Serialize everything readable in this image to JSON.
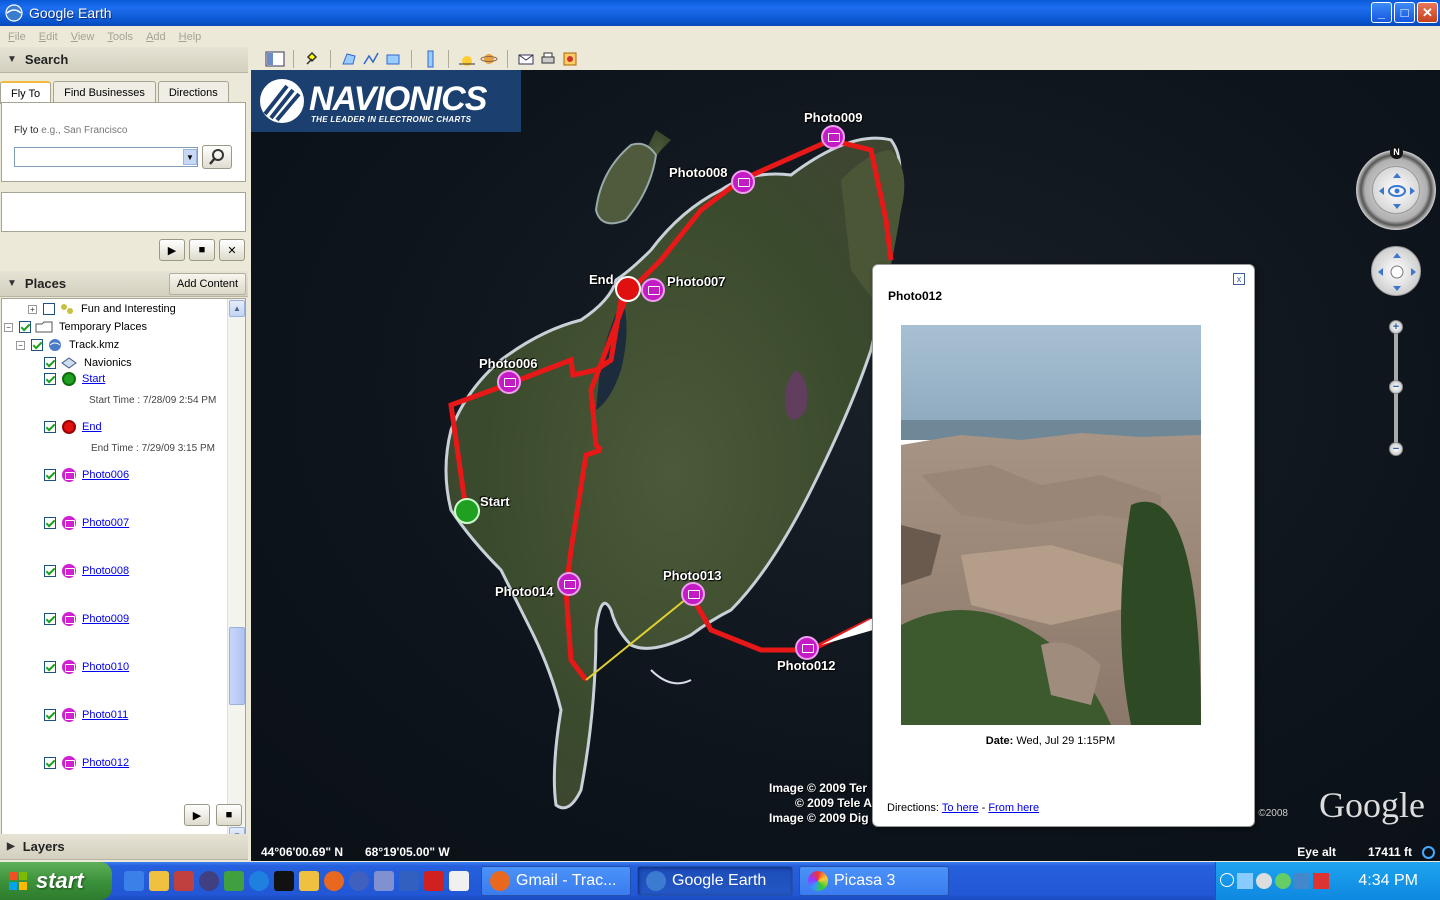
{
  "window": {
    "title": "Google Earth",
    "controls": {
      "minimize": "_",
      "maximize": "□",
      "close": "✕"
    }
  },
  "menu": [
    "File",
    "Edit",
    "View",
    "Tools",
    "Add",
    "Help"
  ],
  "search": {
    "header": "Search",
    "tabs": [
      "Fly To",
      "Find Businesses",
      "Directions"
    ],
    "flyto_label": "Fly to",
    "flyto_example": "e.g., San Francisco",
    "flyto_value": ""
  },
  "places": {
    "header": "Places",
    "add_content": "Add Content",
    "items": [
      {
        "label": "Fun and Interesting",
        "checked": false
      },
      {
        "label": "Temporary Places",
        "checked": true
      },
      {
        "label": "Track.kmz",
        "checked": true
      },
      {
        "label": "Navionics",
        "checked": true
      },
      {
        "label": "Start",
        "checked": true,
        "sub": "Start Time : 7/28/09 2:54 PM"
      },
      {
        "label": "End",
        "checked": true,
        "sub": "End Time : 7/29/09 3:15 PM"
      },
      {
        "label": "Photo006",
        "checked": true
      },
      {
        "label": "Photo007",
        "checked": true
      },
      {
        "label": "Photo008",
        "checked": true
      },
      {
        "label": "Photo009",
        "checked": true
      },
      {
        "label": "Photo010",
        "checked": true
      },
      {
        "label": "Photo011",
        "checked": true
      },
      {
        "label": "Photo012",
        "checked": true
      }
    ]
  },
  "layers": {
    "header": "Layers"
  },
  "map": {
    "navionics_brand": "NAVIONICS",
    "navionics_tagline": "THE LEADER IN ELECTRONIC CHARTS",
    "labels": {
      "photo009": "Photo009",
      "photo008": "Photo008",
      "photo007": "Photo007",
      "photo006": "Photo006",
      "photo013": "Photo013",
      "photo014": "Photo014",
      "photo012": "Photo012",
      "start": "Start",
      "end": "End"
    },
    "credits": [
      "Image © 2009 Ter",
      "© 2009 Tele A",
      "Image © 2009 Dig"
    ],
    "google_year": "©2008",
    "google": "Google",
    "coords": {
      "lat": "44°06'00.69\" N",
      "lon": "68°19'05.00\" W"
    },
    "eye_alt_label": "Eye alt",
    "eye_alt_value": "17411 ft",
    "compass_n": "N"
  },
  "balloon": {
    "title": "Photo012",
    "date_label": "Date:",
    "date_value": "Wed, Jul 29 1:15PM",
    "directions_label": "Directions:",
    "to_here": "To here",
    "separator": "-",
    "from_here": "From here",
    "close": "x"
  },
  "taskbar": {
    "start": "start",
    "tasks": [
      {
        "label": "Gmail - Trac...",
        "active": false
      },
      {
        "label": "Google Earth",
        "active": true
      },
      {
        "label": "Picasa 3",
        "active": false
      }
    ],
    "clock": "4:34 PM"
  },
  "colors": {
    "track": "#e81818",
    "photo_pin": "#c41cc4",
    "xp_blue": "#2257d6",
    "start_green": "#3c923b"
  }
}
